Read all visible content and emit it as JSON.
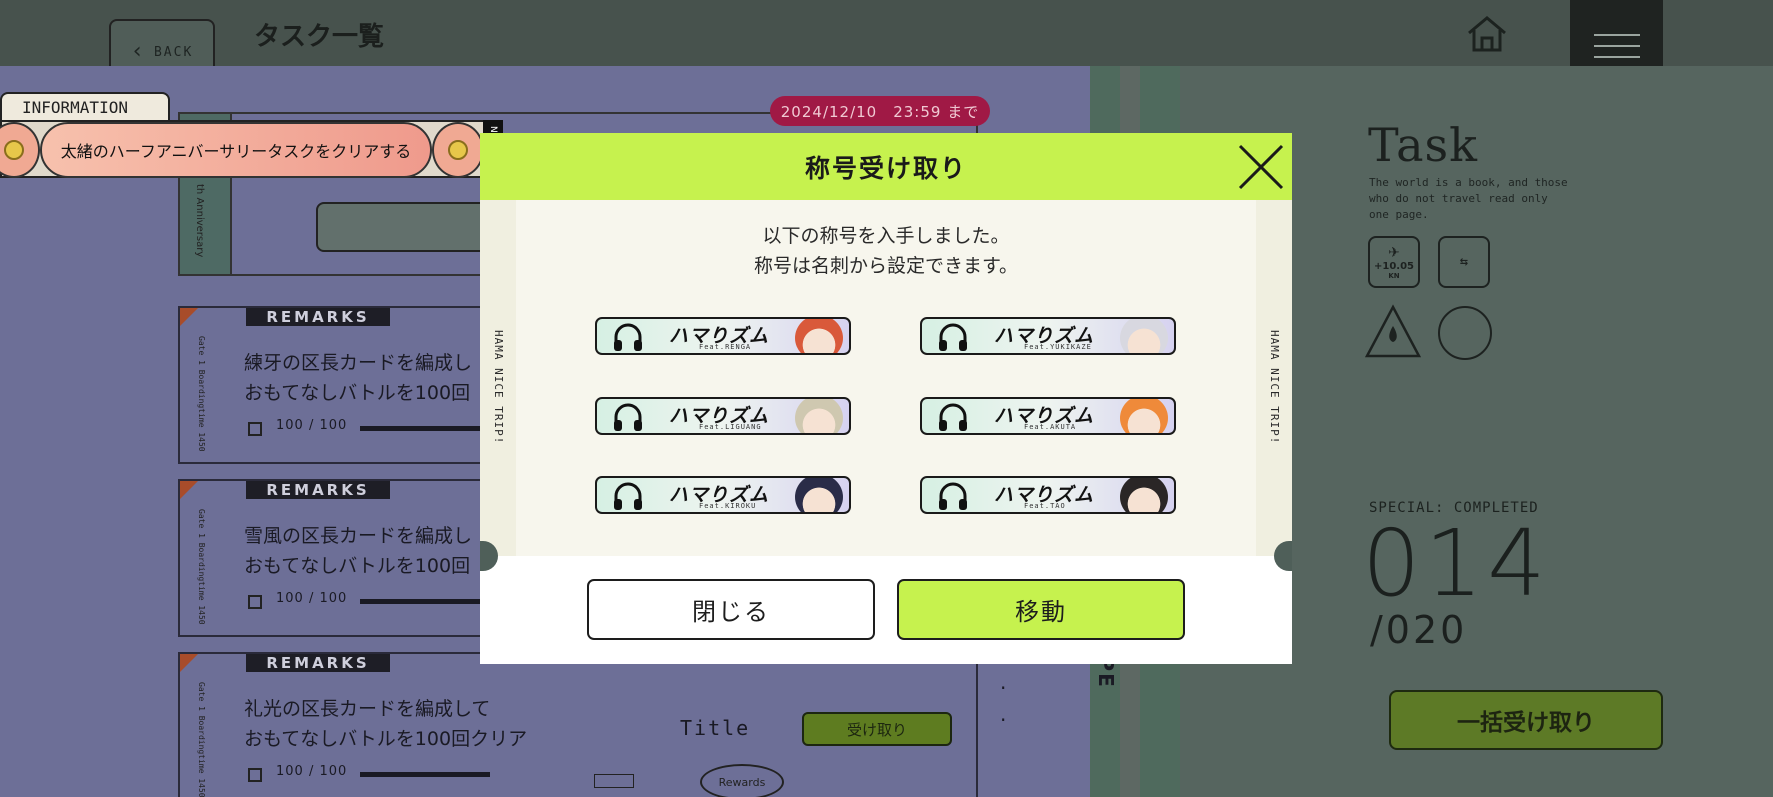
{
  "header": {
    "back_label": "BACK",
    "title": "タスク一覧",
    "home_icon": "home-icon",
    "menu_icon": "hamburger-menu-icon"
  },
  "info": {
    "tag": "INFORMATION",
    "message": "太緒のハーフアニバーサリータスクをクリアする",
    "normal_tag": "NORMAL"
  },
  "deadline": "2024/12/10　23:59 まで",
  "anniversary_side": "th Anniversary",
  "tasks": [
    {
      "remarks": "REMARKS",
      "gate": "Gate 1 Boardingtime 1450",
      "line1": "練牙の区長カードを編成し",
      "line2": "おもてなしバトルを100回",
      "progress": "100 / 100"
    },
    {
      "remarks": "REMARKS",
      "gate": "Gate 1 Boardingtime 1450",
      "line1": "雪風の区長カードを編成し",
      "line2": "おもてなしバトルを100回",
      "progress": "100 / 100"
    },
    {
      "remarks": "REMARKS",
      "gate": "Gate 1 Boardingtime 1450",
      "line1": "礼光の区長カードを編成して",
      "line2": "おもてなしバトルを100回クリア",
      "progress": "100 / 100",
      "reward_type": "Title",
      "receive_label": "受け取り",
      "rewards_label": "Rewards"
    }
  ],
  "right_panel": {
    "heading": "Task",
    "quote": "The world is a book, and those who do not travel read only one page.",
    "icon_speed": "+10.05",
    "icon_speed_unit": "KN",
    "special_label": "SPECIAL: COMPLETED",
    "completed": "014",
    "total": "/020",
    "bulk_receive": "一括受け取り",
    "side_label": "SPE"
  },
  "modal": {
    "title": "称号受け取り",
    "message_line1": "以下の称号を入手しました。",
    "message_line2": "称号は名刺から設定できます。",
    "side_text": "HAMA NICE TRIP!",
    "badges": [
      {
        "name": "ハマりズム",
        "feat": "Feat.RENGA",
        "face_color": "#d9593a"
      },
      {
        "name": "ハマりズム",
        "feat": "Feat.YUKIKAZE",
        "face_color": "#d8d8e0"
      },
      {
        "name": "ハマりズム",
        "feat": "Feat.LIGUANG",
        "face_color": "#cfc8b0"
      },
      {
        "name": "ハマりズム",
        "feat": "Feat.AKUTA",
        "face_color": "#ef8a3a"
      },
      {
        "name": "ハマりズム",
        "feat": "Feat.KIROKU",
        "face_color": "#2a2c48"
      },
      {
        "name": "ハマりズム",
        "feat": "Feat.TAO",
        "face_color": "#2a2626"
      }
    ],
    "close_label": "閉じる",
    "move_label": "移動"
  },
  "colors": {
    "accent_green": "#c6f24e",
    "deadline_pink": "#a01945"
  }
}
